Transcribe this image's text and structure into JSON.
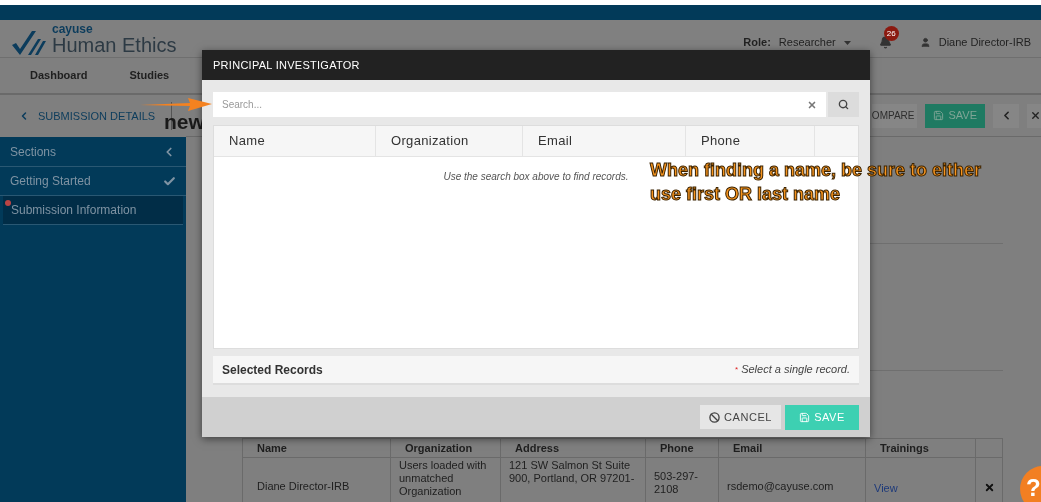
{
  "app": {
    "brand_small": "cayuse",
    "brand_large": "Human Ethics",
    "role_label": "Role:",
    "role_value": "Researcher",
    "notifications": "26",
    "user": "Diane Director-IRB"
  },
  "nav": [
    {
      "label": "Dashboard"
    },
    {
      "label": "Studies"
    }
  ],
  "toolbar": {
    "back": "SUBMISSION DETAILS",
    "title": "new",
    "compare": "OMPARE",
    "save": "SAVE"
  },
  "sidebar": {
    "title": "Sections",
    "items": [
      {
        "label": "Getting Started",
        "selected": false,
        "complete": true,
        "error": false
      },
      {
        "label": "Submission Information",
        "selected": true,
        "complete": false,
        "error": true
      }
    ]
  },
  "table": {
    "columns": [
      "Name",
      "Organization",
      "Address",
      "Phone",
      "Email",
      "Trainings"
    ],
    "rows": [
      {
        "name": "Diane Director-IRB",
        "organization": "Users loaded with unmatched Organization",
        "address": "121 SW Salmon St Suite 900, Portland, OR 97201-",
        "phone": "503-297-2108",
        "email": "rsdemo@cayuse.com",
        "trainings": "View"
      }
    ]
  },
  "modal": {
    "title": "PRINCIPAL INVESTIGATOR",
    "search": {
      "placeholder": "Search..."
    },
    "columns": [
      "Name",
      "Organization",
      "Email",
      "Phone"
    ],
    "empty_message": "Use the search box above to find records.",
    "selected_title": "Selected Records",
    "required_mark": "*",
    "hint": "Select a single record.",
    "cancel": "CANCEL",
    "save": "SAVE"
  },
  "annotation": "When finding a name, be sure to either use first OR last name",
  "help": "?"
}
